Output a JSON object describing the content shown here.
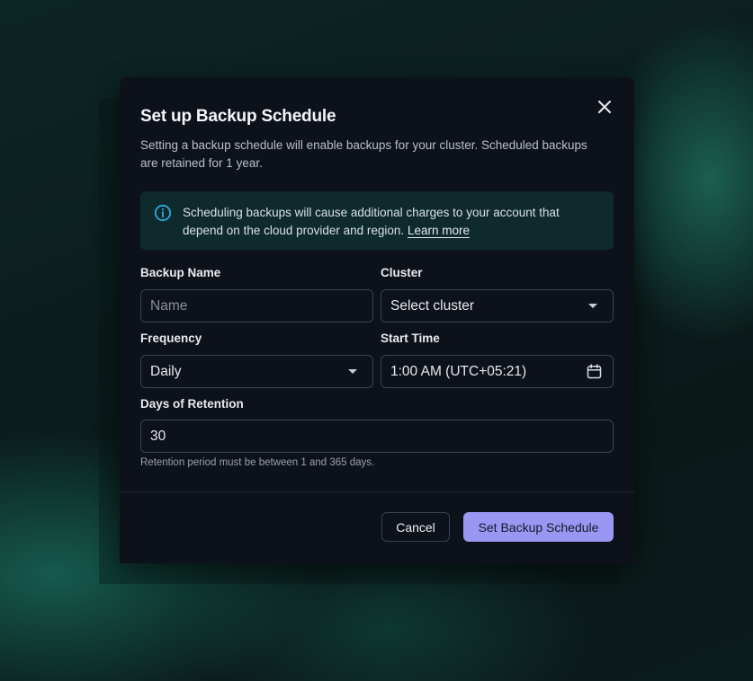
{
  "dialog": {
    "title": "Set up Backup Schedule",
    "description": "Setting a backup schedule will enable backups for your cluster. Scheduled backups are retained for 1 year.",
    "close_icon": "close-icon"
  },
  "notice": {
    "icon": "info-icon",
    "text": "Scheduling backups will cause additional charges to your account that depend on the cloud provider and region. ",
    "link": "Learn more",
    "accent_color": "#2fa7d9"
  },
  "form": {
    "backup_name": {
      "label": "Backup Name",
      "value": "",
      "placeholder": "Name"
    },
    "cluster": {
      "label": "Cluster",
      "value": "Select cluster",
      "icon": "chevron-down-icon"
    },
    "frequency": {
      "label": "Frequency",
      "value": "Daily",
      "icon": "chevron-down-icon"
    },
    "start_time": {
      "label": "Start Time",
      "value": "1:00 AM (UTC+05:21)",
      "icon": "calendar-icon"
    },
    "retention": {
      "label": "Days of Retention",
      "value": "30",
      "helper": "Retention period must be between 1 and 365 days."
    }
  },
  "footer": {
    "cancel_label": "Cancel",
    "submit_label": "Set Backup Schedule",
    "primary_color": "#9a97f2"
  }
}
